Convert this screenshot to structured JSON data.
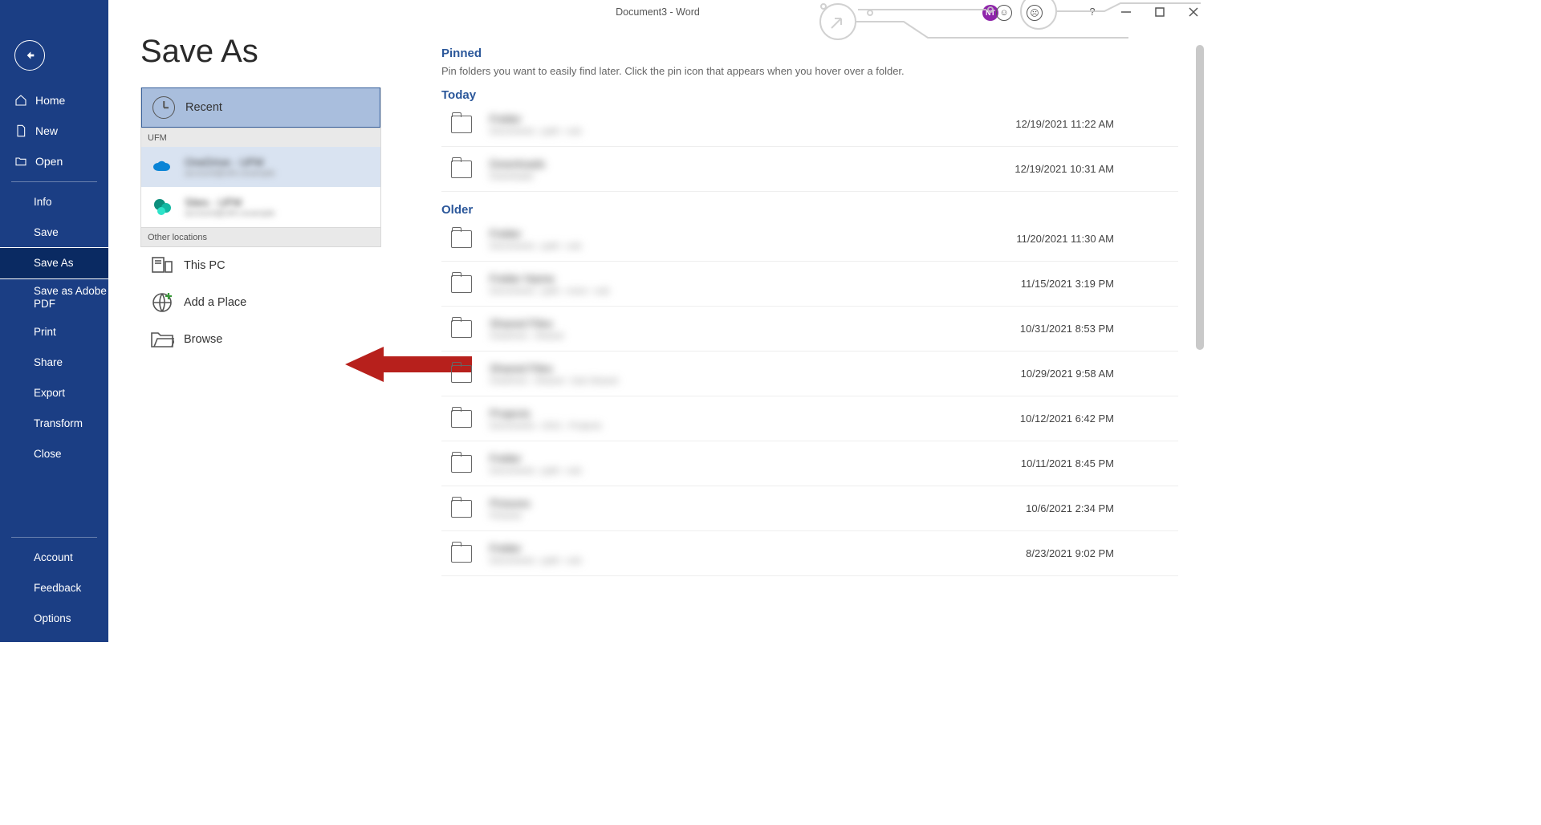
{
  "titlebar": {
    "title": "Document3  -  Word",
    "avatar": "NT"
  },
  "page": {
    "title": "Save As"
  },
  "sidebar": {
    "home": "Home",
    "new": "New",
    "open": "Open",
    "info": "Info",
    "save": "Save",
    "save_as": "Save As",
    "save_pdf": "Save as Adobe PDF",
    "print": "Print",
    "share": "Share",
    "export": "Export",
    "transform": "Transform",
    "close": "Close",
    "account": "Account",
    "feedback": "Feedback",
    "options": "Options"
  },
  "locations": {
    "recent": "Recent",
    "section_ufm": "UFM",
    "onedrive_name": "OneDrive - UFM",
    "onedrive_sub": "account@ufm.example",
    "sites_name": "Sites - UFM",
    "sites_sub": "account@ufm.example",
    "section_other": "Other locations",
    "this_pc": "This PC",
    "add_place": "Add a Place",
    "browse": "Browse"
  },
  "files": {
    "pinned_title": "Pinned",
    "pinned_hint": "Pin folders you want to easily find later. Click the pin icon that appears when you hover over a folder.",
    "today_title": "Today",
    "older_title": "Older",
    "today": [
      {
        "name": "Folder",
        "path": "Documents › path › sub",
        "date": "12/19/2021 11:22 AM"
      },
      {
        "name": "Downloads",
        "path": "Downloads",
        "date": "12/19/2021 10:31 AM"
      }
    ],
    "older": [
      {
        "name": "Folder",
        "path": "Documents › path › sub",
        "date": "11/20/2021 11:30 AM"
      },
      {
        "name": "Folder Name",
        "path": "Documents › path › more › sub",
        "date": "11/15/2021 3:19 PM"
      },
      {
        "name": "Shared Files",
        "path": "OneDrive › Shared",
        "date": "10/31/2021 8:53 PM"
      },
      {
        "name": "Shared Files",
        "path": "OneDrive › Shared › Sub Shared",
        "date": "10/29/2021 9:58 AM"
      },
      {
        "name": "Projects",
        "path": "Documents › 2021 › Projects",
        "date": "10/12/2021 6:42 PM"
      },
      {
        "name": "Folder",
        "path": "Documents › path › sub",
        "date": "10/11/2021 8:45 PM"
      },
      {
        "name": "Pictures",
        "path": "Pictures",
        "date": "10/6/2021 2:34 PM"
      },
      {
        "name": "Folder",
        "path": "Documents › path › sub",
        "date": "8/23/2021 9:02 PM"
      }
    ]
  }
}
